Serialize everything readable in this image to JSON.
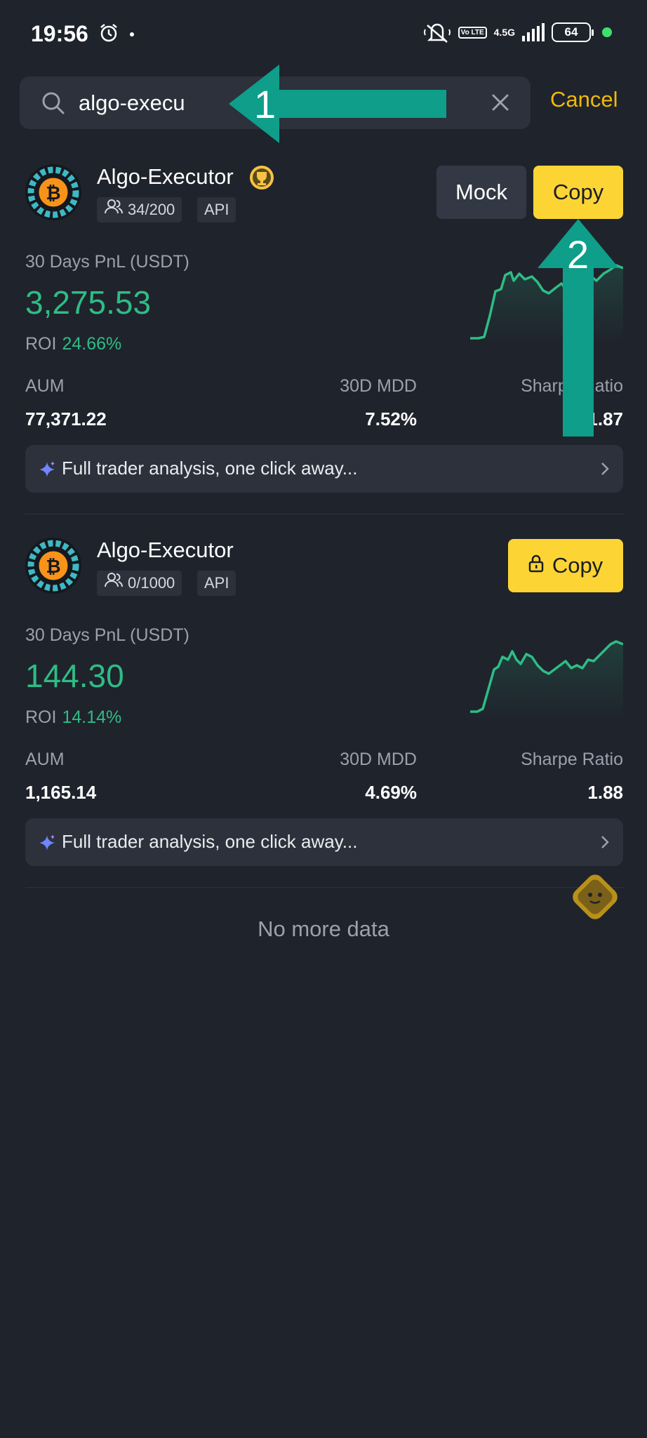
{
  "status_bar": {
    "time": "19:56",
    "network_type": "4.5G",
    "volte": "Vo LTE",
    "battery": "64",
    "icons": [
      "alarm-icon",
      "mute-icon",
      "signal-icon",
      "battery-icon"
    ]
  },
  "search": {
    "query": "algo-execu",
    "cancel_label": "Cancel"
  },
  "results": [
    {
      "name": "Algo-Executor",
      "followers": "34/200",
      "tag": "API",
      "mock_label": "Mock",
      "copy_label": "Copy",
      "pnl_label": "30 Days PnL (USDT)",
      "pnl_value": "3,275.53",
      "roi_label": "ROI",
      "roi_value": "24.66%",
      "stats": {
        "aum_label": "AUM",
        "aum_value": "77,371.22",
        "mdd_label": "30D MDD",
        "mdd_value": "7.52%",
        "sharpe_label": "Sharpe Ratio",
        "sharpe_value": "1.87"
      },
      "analysis_label": "Full trader analysis, one click away..."
    },
    {
      "name": "Algo-Executor",
      "followers": "0/1000",
      "tag": "API",
      "copy_label": "Copy",
      "pnl_label": "30 Days PnL (USDT)",
      "pnl_value": "144.30",
      "roi_label": "ROI",
      "roi_value": "14.14%",
      "stats": {
        "aum_label": "AUM",
        "aum_value": "1,165.14",
        "mdd_label": "30D MDD",
        "mdd_value": "4.69%",
        "sharpe_label": "Sharpe Ratio",
        "sharpe_value": "1.88"
      },
      "analysis_label": "Full trader analysis, one click away..."
    }
  ],
  "footer": {
    "no_more": "No more data"
  },
  "annotations": {
    "arrow_1": "1",
    "arrow_2": "2"
  },
  "colors": {
    "background": "#1f232c",
    "accent_yellow": "#fcd535",
    "cancel_yellow": "#f0b90b",
    "profit_green": "#2ebd85",
    "annotation_teal": "#0e9e8a"
  }
}
